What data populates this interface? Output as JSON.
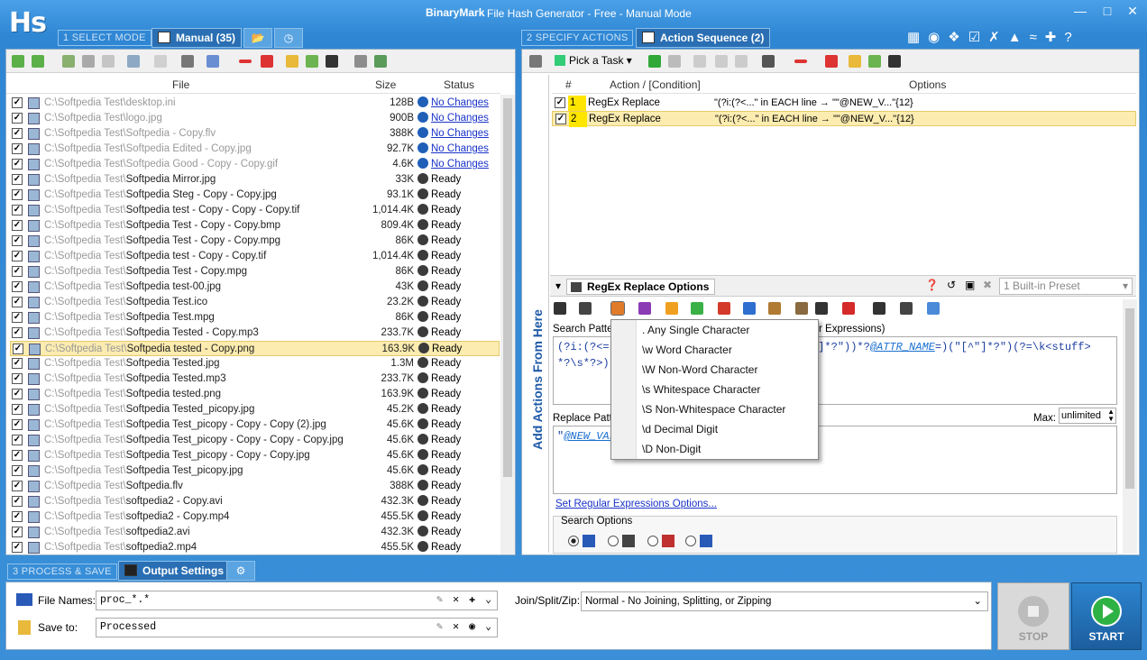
{
  "app": {
    "logo": "Hs",
    "brand": "BinaryMark",
    "title": "File Hash Generator - Free - Manual Mode"
  },
  "steps": {
    "s1": "1 SELECT MODE",
    "s2": "2 SPECIFY ACTIONS",
    "s3": "3 PROCESS & SAVE"
  },
  "tabs": {
    "manual": "Manual (35)",
    "action_sequence": "Action Sequence (2)",
    "output_settings": "Output Settings"
  },
  "files": {
    "columns": [
      "File",
      "Size",
      "Status"
    ],
    "rows": [
      {
        "path": "C:\\Softpedia Test\\",
        "name": "desktop.ini",
        "size": "128B",
        "status": "No Changes",
        "linked": true,
        "dim": true
      },
      {
        "path": "C:\\Softpedia Test\\",
        "name": "logo.jpg",
        "size": "900B",
        "status": "No Changes",
        "linked": true,
        "dim": true
      },
      {
        "path": "C:\\Softpedia Test\\",
        "name": "Softpedia - Copy.flv",
        "size": "388K",
        "status": "No Changes",
        "linked": true,
        "dim": true
      },
      {
        "path": "C:\\Softpedia Test\\",
        "name": "Softpedia Edited - Copy.jpg",
        "size": "92.7K",
        "status": "No Changes",
        "linked": true,
        "dim": true
      },
      {
        "path": "C:\\Softpedia Test\\",
        "name": "Softpedia Good - Copy - Copy.gif",
        "size": "4.6K",
        "status": "No Changes",
        "linked": true,
        "dim": true
      },
      {
        "path": "C:\\Softpedia Test\\",
        "name": "Softpedia Mirror.jpg",
        "size": "33K",
        "status": "Ready"
      },
      {
        "path": "C:\\Softpedia Test\\",
        "name": "Softpedia Steg - Copy - Copy.jpg",
        "size": "93.1K",
        "status": "Ready"
      },
      {
        "path": "C:\\Softpedia Test\\",
        "name": "Softpedia test - Copy - Copy - Copy.tif",
        "size": "1,014.4K",
        "status": "Ready"
      },
      {
        "path": "C:\\Softpedia Test\\",
        "name": "Softpedia Test - Copy - Copy.bmp",
        "size": "809.4K",
        "status": "Ready"
      },
      {
        "path": "C:\\Softpedia Test\\",
        "name": "Softpedia Test - Copy - Copy.mpg",
        "size": "86K",
        "status": "Ready"
      },
      {
        "path": "C:\\Softpedia Test\\",
        "name": "Softpedia test - Copy - Copy.tif",
        "size": "1,014.4K",
        "status": "Ready"
      },
      {
        "path": "C:\\Softpedia Test\\",
        "name": "Softpedia Test - Copy.mpg",
        "size": "86K",
        "status": "Ready"
      },
      {
        "path": "C:\\Softpedia Test\\",
        "name": "Softpedia test-00.jpg",
        "size": "43K",
        "status": "Ready"
      },
      {
        "path": "C:\\Softpedia Test\\",
        "name": "Softpedia Test.ico",
        "size": "23.2K",
        "status": "Ready"
      },
      {
        "path": "C:\\Softpedia Test\\",
        "name": "Softpedia Test.mpg",
        "size": "86K",
        "status": "Ready"
      },
      {
        "path": "C:\\Softpedia Test\\",
        "name": "Softpedia Tested - Copy.mp3",
        "size": "233.7K",
        "status": "Ready"
      },
      {
        "path": "C:\\Softpedia Test\\",
        "name": "Softpedia tested - Copy.png",
        "size": "163.9K",
        "status": "Ready",
        "selected": true
      },
      {
        "path": "C:\\Softpedia Test\\",
        "name": "Softpedia Tested.jpg",
        "size": "1.3M",
        "status": "Ready"
      },
      {
        "path": "C:\\Softpedia Test\\",
        "name": "Softpedia Tested.mp3",
        "size": "233.7K",
        "status": "Ready"
      },
      {
        "path": "C:\\Softpedia Test\\",
        "name": "Softpedia tested.png",
        "size": "163.9K",
        "status": "Ready"
      },
      {
        "path": "C:\\Softpedia Test\\",
        "name": "Softpedia Tested_picopy.jpg",
        "size": "45.2K",
        "status": "Ready"
      },
      {
        "path": "C:\\Softpedia Test\\",
        "name": "Softpedia Test_picopy - Copy - Copy (2).jpg",
        "size": "45.6K",
        "status": "Ready"
      },
      {
        "path": "C:\\Softpedia Test\\",
        "name": "Softpedia Test_picopy - Copy - Copy - Copy.jpg",
        "size": "45.6K",
        "status": "Ready"
      },
      {
        "path": "C:\\Softpedia Test\\",
        "name": "Softpedia Test_picopy - Copy - Copy.jpg",
        "size": "45.6K",
        "status": "Ready"
      },
      {
        "path": "C:\\Softpedia Test\\",
        "name": "Softpedia Test_picopy.jpg",
        "size": "45.6K",
        "status": "Ready"
      },
      {
        "path": "C:\\Softpedia Test\\",
        "name": "Softpedia.flv",
        "size": "388K",
        "status": "Ready"
      },
      {
        "path": "C:\\Softpedia Test\\",
        "name": "softpedia2 - Copy.avi",
        "size": "432.3K",
        "status": "Ready"
      },
      {
        "path": "C:\\Softpedia Test\\",
        "name": "softpedia2 - Copy.mp4",
        "size": "455.5K",
        "status": "Ready"
      },
      {
        "path": "C:\\Softpedia Test\\",
        "name": "softpedia2.avi",
        "size": "432.3K",
        "status": "Ready"
      },
      {
        "path": "C:\\Softpedia Test\\",
        "name": "softpedia2.mp4",
        "size": "455.5K",
        "status": "Ready"
      }
    ]
  },
  "actions": {
    "pick_task": "Pick a Task",
    "columns": [
      "#",
      "Action / [Condition]",
      "Options"
    ],
    "rows": [
      {
        "num": "1",
        "action": "RegEx Replace",
        "options": "\"(?i:(?<...\" in EACH line → \"\"@NEW_V...\"{12}"
      },
      {
        "num": "2",
        "action": "RegEx Replace",
        "options": "\"(?i:(?<...\" in EACH line → \"\"@NEW_V...\"{12}",
        "selected": true
      }
    ],
    "side_label": "Add Actions From Here"
  },
  "regex": {
    "panel_title": "RegEx Replace Options",
    "preset": "1 Built-in Preset",
    "search_label": "Search Patte",
    "search_tail": "r Expressions)",
    "pattern_l1a": "(?i:(?<=",
    "pattern_l1b": "[^\"]*?\"))*?",
    "pattern_attr": "@ATTR_NAME",
    "pattern_l1c": "=)(\"[^\"]*?\")(?=\\k<stuff>",
    "pattern_l2": "*?\\s*?>)",
    "replace_label": "Replace Patte",
    "replace_prefix": "\"",
    "replace_var": "@NEW_VAL",
    "max_label": "Max:",
    "max_value": "unlimited",
    "set_options_link": "Set Regular Expressions Options...",
    "search_options": "Search Options"
  },
  "menu": {
    "items": [
      ". Any Single Character",
      "\\w Word Character",
      "\\W Non-Word Character",
      "\\s Whitespace Character",
      "\\S Non-Whitespace Character",
      "\\d Decimal Digit",
      "\\D Non-Digit"
    ]
  },
  "output": {
    "file_names_label": "File Names:",
    "file_names_value": "proc_*.*",
    "save_to_label": "Save to:",
    "save_to_value": "Processed",
    "join_label": "Join/Split/Zip:",
    "join_value": "Normal - No Joining, Splitting, or Zipping",
    "stop": "STOP",
    "start": "START"
  }
}
